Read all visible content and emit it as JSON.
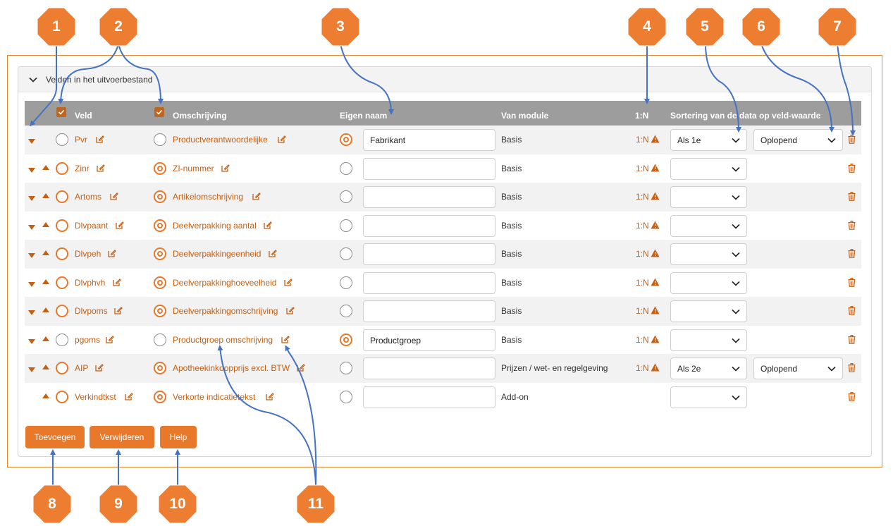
{
  "panel": {
    "title": "Velden in het uitvoerbestand"
  },
  "headers": {
    "veld": "Veld",
    "omschrijving": "Omschrijving",
    "eigen_naam": "Eigen naam",
    "van_module": "Van module",
    "n1": "1:N",
    "sortering": "Sortering van de data op veld-waarde"
  },
  "rows": [
    {
      "veld": "Pvr",
      "omschrijving": "Productverantwoordelijke",
      "eigen_naam": "Fabrikant",
      "module": "Basis",
      "n1": "1:N",
      "sort1": "Als 1e",
      "sort2": "Oplopend"
    },
    {
      "veld": "Zinr",
      "omschrijving": "ZI-nummer",
      "eigen_naam": "",
      "module": "Basis",
      "n1": "1:N",
      "sort1": ""
    },
    {
      "veld": "Artoms",
      "omschrijving": "Artikelomschrijving",
      "eigen_naam": "",
      "module": "Basis",
      "n1": "1:N",
      "sort1": ""
    },
    {
      "veld": "Dlvpaant",
      "omschrijving": "Deelverpakking aantal",
      "eigen_naam": "",
      "module": "Basis",
      "n1": "1:N",
      "sort1": ""
    },
    {
      "veld": "Dlvpeh",
      "omschrijving": "Deelverpakkingeenheid",
      "eigen_naam": "",
      "module": "Basis",
      "n1": "1:N",
      "sort1": ""
    },
    {
      "veld": "Dlvphvh",
      "omschrijving": "Deelverpakkinghoeveelheid",
      "eigen_naam": "",
      "module": "Basis",
      "n1": "1:N",
      "sort1": ""
    },
    {
      "veld": "Dlvpoms",
      "omschrijving": "Deelverpakkingomschrijving",
      "eigen_naam": "",
      "module": "Basis",
      "n1": "1:N",
      "sort1": ""
    },
    {
      "veld": "pgoms",
      "omschrijving": "Productgroep omschrijving",
      "eigen_naam": "Productgroep",
      "module": "Basis",
      "n1": "1:N",
      "sort1": ""
    },
    {
      "veld": "AIP",
      "omschrijving": "Apotheekinkoopprijs excl. BTW",
      "eigen_naam": "",
      "module": "Prijzen / wet- en regelgeving",
      "n1": "1:N",
      "sort1": "Als 2e",
      "sort2": "Oplopend"
    },
    {
      "veld": "Verkindtkst",
      "omschrijving": "Verkorte indicatietekst",
      "eigen_naam": "",
      "module": "Add-on",
      "n1": "",
      "sort1": ""
    }
  ],
  "buttons": {
    "toevoegen": "Toevoegen",
    "verwijderen": "Verwijderen",
    "help": "Help"
  },
  "callouts": [
    "1",
    "2",
    "3",
    "4",
    "5",
    "6",
    "7",
    "8",
    "9",
    "10",
    "11"
  ],
  "colors": {
    "accent": "#e8782a",
    "link": "#c55f12",
    "header_bg": "#9d9d9d",
    "callout": "#ed7d31",
    "callout_line": "#4472c4"
  }
}
